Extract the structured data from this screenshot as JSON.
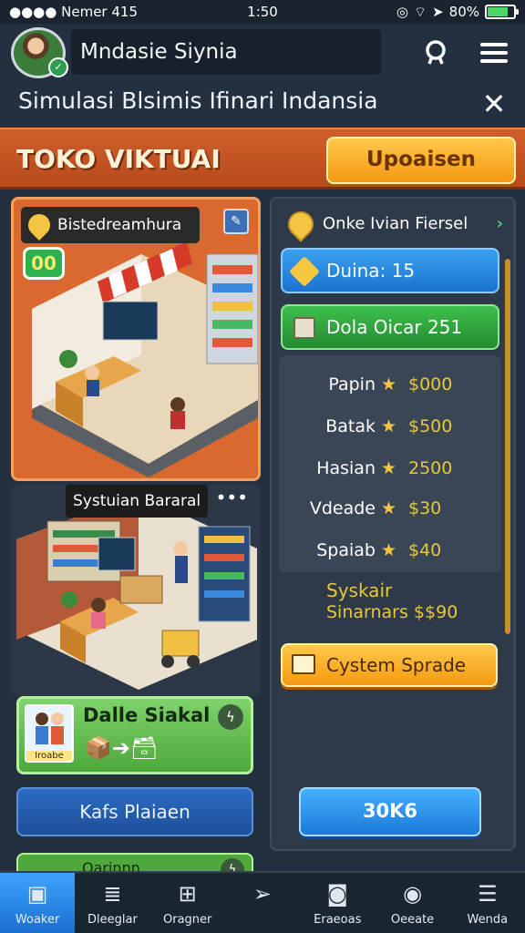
{
  "status_bar": {
    "carrier": "Nemer",
    "signal_text": "415",
    "time": "1:50",
    "battery": "80%",
    "battery_level": 0.8
  },
  "profile": {
    "name": "Mndasie Siynia"
  },
  "title": "Simulasi Blsimis Ifinari Indansia",
  "banner": {
    "title": "TOKO VIKTUAI",
    "button": "Upoaisen"
  },
  "card1": {
    "header": "Bistedreamhura",
    "level": "00"
  },
  "card2": {
    "header": "Systuian Bararal"
  },
  "green_card": {
    "title": "Dalle Siakal",
    "thumb_label": "Iroabe"
  },
  "blue_card": {
    "label": "Kafs Plaiaen"
  },
  "cut_card": {
    "label": "Oarinnn"
  },
  "right_panel": {
    "header": "Onke Ivian Fiersel",
    "blue_pill": "Duina: 15",
    "green_pill": "Dola Oicar 251",
    "list": [
      {
        "name": "Papin",
        "price": "$000"
      },
      {
        "name": "Batak",
        "price": "$500"
      },
      {
        "name": "Hasian",
        "price": "2500"
      },
      {
        "name": "Vdeade",
        "price": "$30"
      },
      {
        "name": "Spaiab",
        "price": "$40"
      }
    ],
    "syskair_line1": "Syskair",
    "syskair_line2": "Sinarnars $$90",
    "orange_button": "Cystem Sprade",
    "blue_button": "30K6"
  },
  "nav": [
    {
      "label": "Woaker",
      "icon": "box-icon"
    },
    {
      "label": "Dleeglar",
      "icon": "stack-icon"
    },
    {
      "label": "Oragner",
      "icon": "robot-icon"
    },
    {
      "label": "",
      "icon": "send-icon"
    },
    {
      "label": "Eraeoas",
      "icon": "camera-icon"
    },
    {
      "label": "Oeeate",
      "icon": "compass-icon"
    },
    {
      "label": "Wenda",
      "icon": "list-icon"
    }
  ],
  "colors": {
    "accent_orange": "#f59a12",
    "accent_blue": "#1c74d0",
    "accent_green": "#238a30",
    "banner": "#cf5e2a",
    "background": "#22303f"
  }
}
